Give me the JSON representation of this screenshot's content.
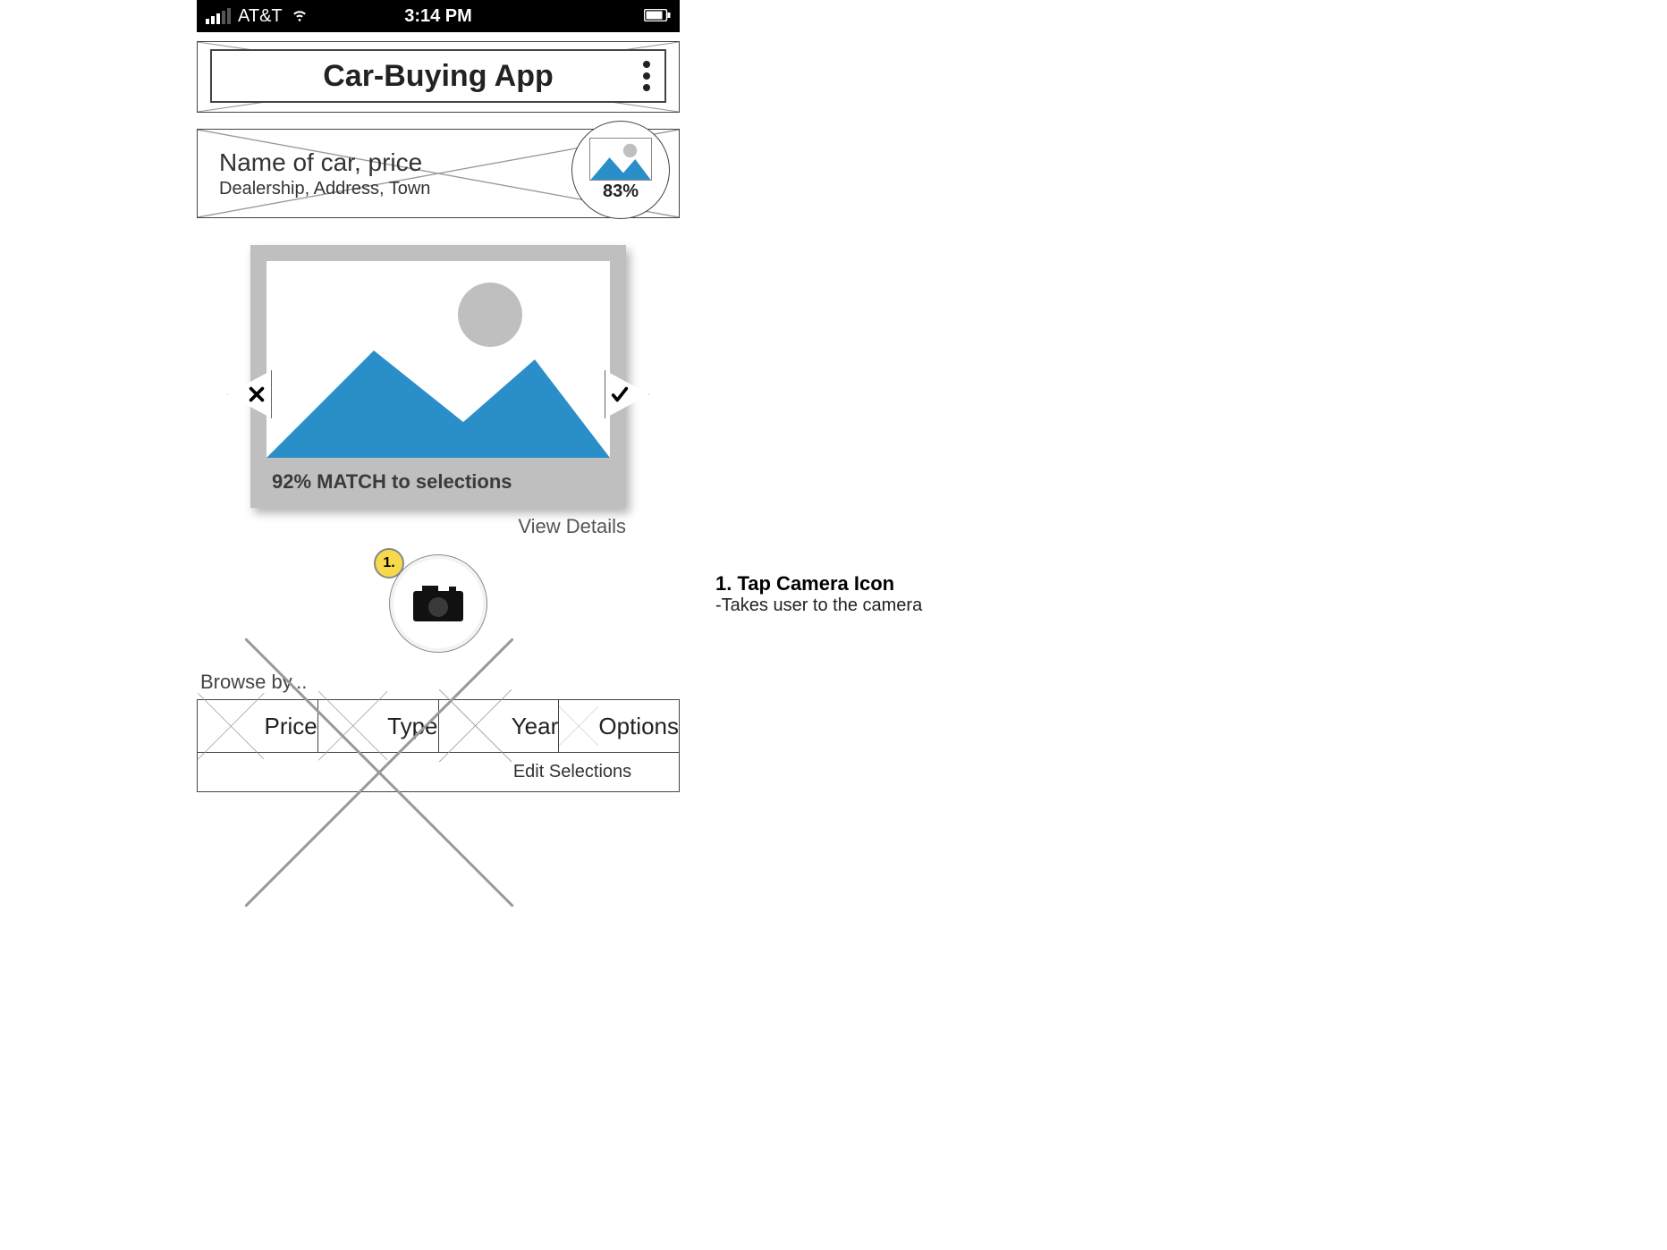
{
  "statusbar": {
    "carrier": "AT&T",
    "time": "3:14 PM"
  },
  "header": {
    "title": "Car-Buying App"
  },
  "car": {
    "name": "Name of car, price",
    "sub": "Dealership, Address, Town",
    "thumb_percent": "83%"
  },
  "main": {
    "match_text": "92%  MATCH to selections",
    "view_details": "View Details"
  },
  "camera": {
    "badge": "1."
  },
  "browse": {
    "label": "Browse by...",
    "items": [
      "Price",
      "Type",
      "Year",
      "Options"
    ],
    "edit": "Edit Selections"
  },
  "annotation": {
    "title": "1. Tap Camera Icon",
    "body": "-Takes user to the camera"
  }
}
